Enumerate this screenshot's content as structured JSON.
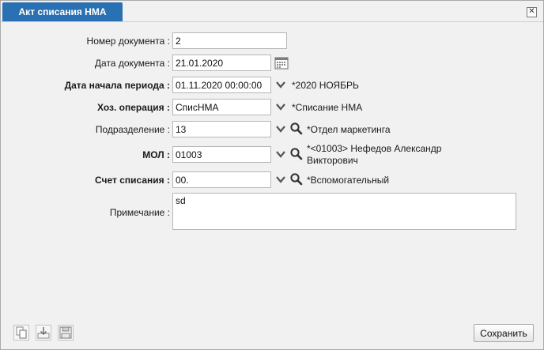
{
  "window": {
    "tab_title": "Акт списания НМА",
    "close_icon": "close-icon"
  },
  "form": {
    "doc_number": {
      "label": "Номер документа :",
      "value": "2"
    },
    "doc_date": {
      "label": "Дата документа :",
      "value": "21.01.2020"
    },
    "period_start": {
      "label": "Дата начала периода :",
      "value": "01.11.2020 00:00:00",
      "note": "*2020 НОЯБРЬ"
    },
    "operation": {
      "label": "Хоз. операция :",
      "value": "СписНМА",
      "note": "*Списание НМА"
    },
    "department": {
      "label": "Подразделение :",
      "value": "13",
      "note": "*Отдел маркетинга"
    },
    "mol": {
      "label": "МОЛ :",
      "value": "01003",
      "note_line1": "*<01003> Нефедов Александр",
      "note_line2": "Викторович"
    },
    "writeoff_account": {
      "label": "Счет списания :",
      "value": "00.",
      "note": "*Вспомогательный"
    },
    "comment": {
      "label": "Примечание :",
      "value": "sd"
    }
  },
  "footer": {
    "save_label": "Сохранить"
  }
}
